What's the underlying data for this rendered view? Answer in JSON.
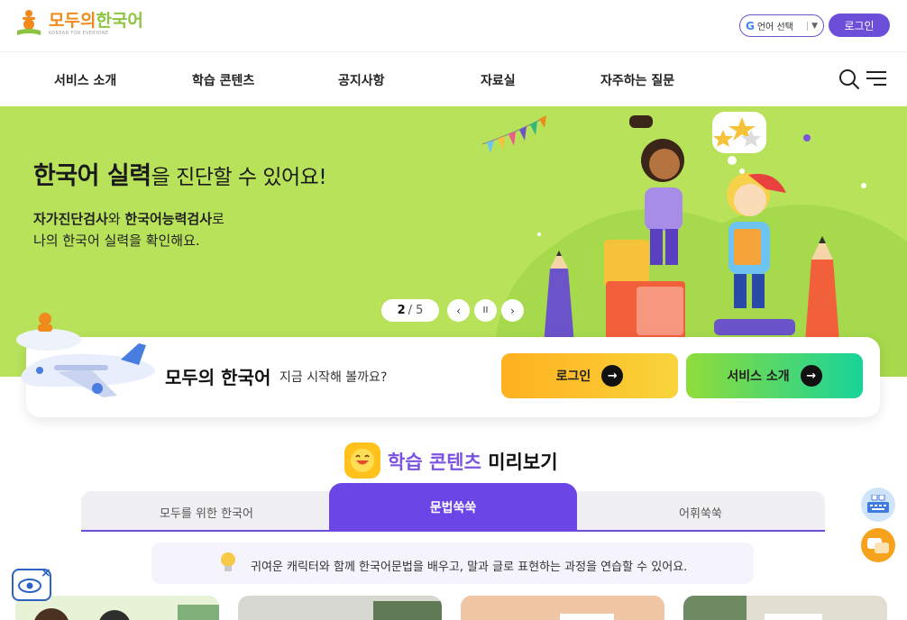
{
  "header": {
    "logo": {
      "name_part1": "모두의",
      "name_part2": "한국어",
      "tagline": "KOREAN FOR EVERYONE"
    },
    "lang_button": {
      "google": "G",
      "label": "언어 선택",
      "caret": "▼"
    },
    "login_label": "로그인"
  },
  "nav": {
    "items": [
      {
        "label": "서비스 소개"
      },
      {
        "label": "학습 콘텐츠"
      },
      {
        "label": "공지사항"
      },
      {
        "label": "자료실"
      },
      {
        "label": "자주하는 질문"
      }
    ],
    "icons": {
      "search": "search-icon",
      "menu": "hamburger-menu-icon"
    }
  },
  "hero": {
    "title_bold": "한국어 실력",
    "title_rest": "을 진단할 수 있어요!",
    "sub1_bold1": "자가진단검사",
    "sub1_mid": "와 ",
    "sub1_bold2": "한국어능력검사",
    "sub1_end": "로",
    "sub2": "나의 한국어 실력을 확인해요.",
    "pager": {
      "current": "2",
      "sep": "/",
      "total": "5"
    },
    "controls": {
      "prev": "‹",
      "pause": "II",
      "next": "›"
    },
    "background_color": "#b7e25a"
  },
  "start_card": {
    "brand": "모두의 한국어",
    "text": "지금 시작해 볼까요?",
    "login_cta": "로그인",
    "service_cta": "서비스 소개",
    "arrow": "→"
  },
  "preview": {
    "title_highlight": "학습 콘텐츠",
    "title_rest": " 미리보기",
    "tabs": [
      {
        "label": "모두를 위한 한국어",
        "active": false
      },
      {
        "label": "문법쑥쑥",
        "active": true
      },
      {
        "label": "어휘쑥쑥",
        "active": false
      }
    ],
    "description": "귀여운 캐릭터와 함께 한국어문법을 배우고, 말과 글로 표현하는 과정을 연습할 수 있어요."
  },
  "floating": {
    "keyboard": "keyboard-icon",
    "chat": "chat-icon",
    "accessibility": "accessibility-eye-icon",
    "close": "×"
  },
  "colors": {
    "brand_purple": "#6b4fd8",
    "hero_green": "#b7e25a",
    "orange": "#f08a1c",
    "green": "#8bc53f"
  }
}
